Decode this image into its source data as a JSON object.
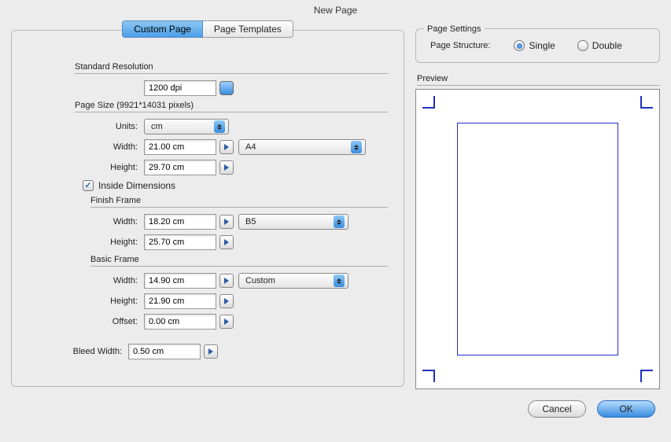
{
  "window_title": "New Page",
  "tabs": {
    "custom": "Custom Page",
    "templates": "Page Templates"
  },
  "sections": {
    "resolution_label": "Standard Resolution",
    "resolution_value": "1200 dpi",
    "page_size_label": "Page Size (9921*14031 pixels)",
    "units_label": "Units:",
    "units_value": "cm",
    "width_label": "Width:",
    "page_width": "21.00 cm",
    "page_preset": "A4",
    "height_label": "Height:",
    "page_height": "29.70 cm",
    "inside_dims_label": "Inside Dimensions",
    "finish_frame_label": "Finish Frame",
    "finish_width": "18.20 cm",
    "finish_preset": "B5",
    "finish_height": "25.70 cm",
    "basic_frame_label": "Basic Frame",
    "basic_width": "14.90 cm",
    "basic_preset": "Custom",
    "basic_height": "21.90 cm",
    "offset_label": "Offset:",
    "offset_value": "0.00 cm",
    "bleed_label": "Bleed Width:",
    "bleed_value": "0.50 cm"
  },
  "page_settings": {
    "title": "Page Settings",
    "structure_label": "Page Structure:",
    "single": "Single",
    "double": "Double"
  },
  "preview_label": "Preview",
  "buttons": {
    "cancel": "Cancel",
    "ok": "OK"
  }
}
